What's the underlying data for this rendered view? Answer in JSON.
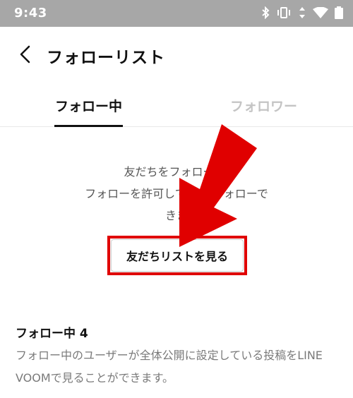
{
  "status_bar": {
    "time": "9:43",
    "icons": [
      "bluetooth-icon",
      "vibrate-icon",
      "data-icon",
      "wifi-icon",
      "battery-icon"
    ]
  },
  "header": {
    "back_icon": "chevron-left-icon",
    "title": "フォローリスト"
  },
  "tabs": [
    {
      "label": "フォロー中",
      "active": true
    },
    {
      "label": "フォロワー",
      "active": false
    }
  ],
  "empty_state": {
    "line1": "友だちをフォロー   ！",
    "line2": "フォローを許可してい      をフォローで",
    "line3": "きま"
  },
  "cta_button": {
    "label": "友だちリストを見る"
  },
  "info": {
    "title": "フォロー中 4",
    "desc": "フォロー中のユーザーが全体公開に設定している投稿をLINE VOOMで見ることができます。"
  },
  "colors": {
    "status_bar": "#a7a7a7",
    "highlight": "#e00000",
    "inactive_tab": "#c4c4c4",
    "text_secondary": "#7a7a7a"
  }
}
